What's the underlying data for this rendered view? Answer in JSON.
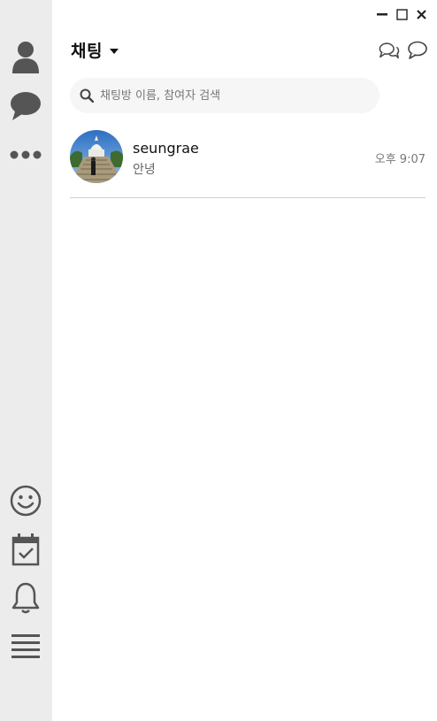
{
  "window": {
    "minimize_icon": "minimize-icon",
    "maximize_icon": "maximize-icon",
    "close_icon": "close-icon"
  },
  "sidebar": {
    "top_items": [
      {
        "icon": "person-icon",
        "name": "friends"
      },
      {
        "icon": "chat-bubble-icon",
        "name": "chats"
      },
      {
        "icon": "more-icon",
        "name": "more"
      }
    ],
    "bottom_items": [
      {
        "icon": "smiley-icon",
        "name": "emoticons"
      },
      {
        "icon": "calendar-check-icon",
        "name": "calendar"
      },
      {
        "icon": "bell-icon",
        "name": "notifications"
      },
      {
        "icon": "menu-icon",
        "name": "menu"
      }
    ]
  },
  "header": {
    "title": "채팅",
    "actions": [
      "open-chat-icon",
      "new-chat-icon"
    ]
  },
  "search": {
    "placeholder": "채팅방 이름, 참여자 검색"
  },
  "chats": [
    {
      "name": "seungrae",
      "last_message": "안녕",
      "time": "오후 9:07"
    }
  ],
  "colors": {
    "sidebar_bg": "#ececec",
    "icon_gray": "#555555",
    "search_bg": "#f6f6f6",
    "divider": "#cfcfcf"
  }
}
